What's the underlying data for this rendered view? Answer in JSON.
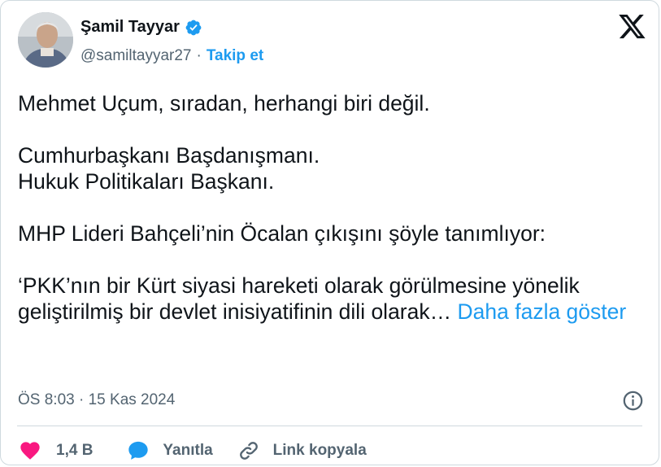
{
  "author": {
    "name": "Şamil Tayyar",
    "handle": "@samiltayyar27",
    "separator": "·",
    "follow_label": "Takip et"
  },
  "icons": {
    "verified": "verified-badge-icon",
    "brand": "x-logo-icon",
    "info": "info-icon",
    "like": "heart-icon",
    "reply": "speech-bubble-icon",
    "link": "link-icon"
  },
  "tweet": {
    "lines": [
      "Mehmet Uçum, sıradan, herhangi biri değil.",
      "Cumhurbaşkanı Başdanışmanı.",
      "Hukuk Politikaları Başkanı.",
      "MHP Lideri Bahçeli’nin Öcalan çıkışını şöyle tanımlıyor:",
      "‘PKK’nın bir Kürt siyasi hareketi olarak görülmesine yönelik geliştirilmiş bir devlet inisiyatifinin dili olarak…"
    ],
    "more_label": "Daha fazla göster"
  },
  "meta": {
    "time": "ÖS 8:03",
    "separator": "·",
    "date": "15 Kas 2024"
  },
  "actions": {
    "like_count": "1,4 B",
    "reply_label": "Yanıtla",
    "copy_link_label": "Link kopyala"
  },
  "colors": {
    "accent": "#1d9bf0",
    "like": "#f91880",
    "secondary_text": "#536471",
    "border": "#cfd9de"
  }
}
